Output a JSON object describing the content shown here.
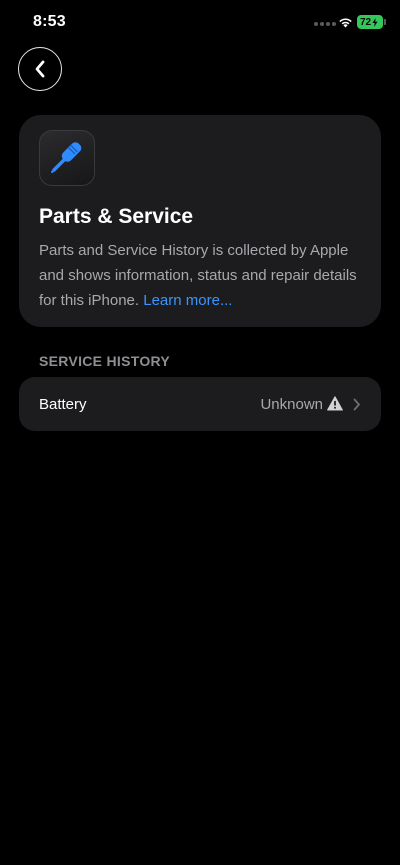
{
  "status_bar": {
    "time": "8:53",
    "battery_level": "72",
    "battery_color": "#34c759",
    "icons": [
      "cellular-signal-icon",
      "wifi-icon",
      "battery-charging-icon"
    ]
  },
  "nav": {
    "back_icon": "chevron-left-icon"
  },
  "info_card": {
    "icon": "screwdriver-icon",
    "icon_color": "#2f8cff",
    "title": "Parts & Service",
    "description": "Parts and Service History is collected by Apple and shows information, status and repair details for this iPhone.",
    "link_text": "Learn more..."
  },
  "service_history": {
    "header": "SERVICE HISTORY",
    "rows": [
      {
        "label": "Battery",
        "value": "Unknown",
        "status_icon": "warning-triangle-icon",
        "disclosure_icon": "chevron-right-icon"
      }
    ]
  },
  "colors": {
    "background": "#000000",
    "card": "#1c1c1e",
    "link": "#3a95ff",
    "secondary_text": "#a8a8ad"
  }
}
